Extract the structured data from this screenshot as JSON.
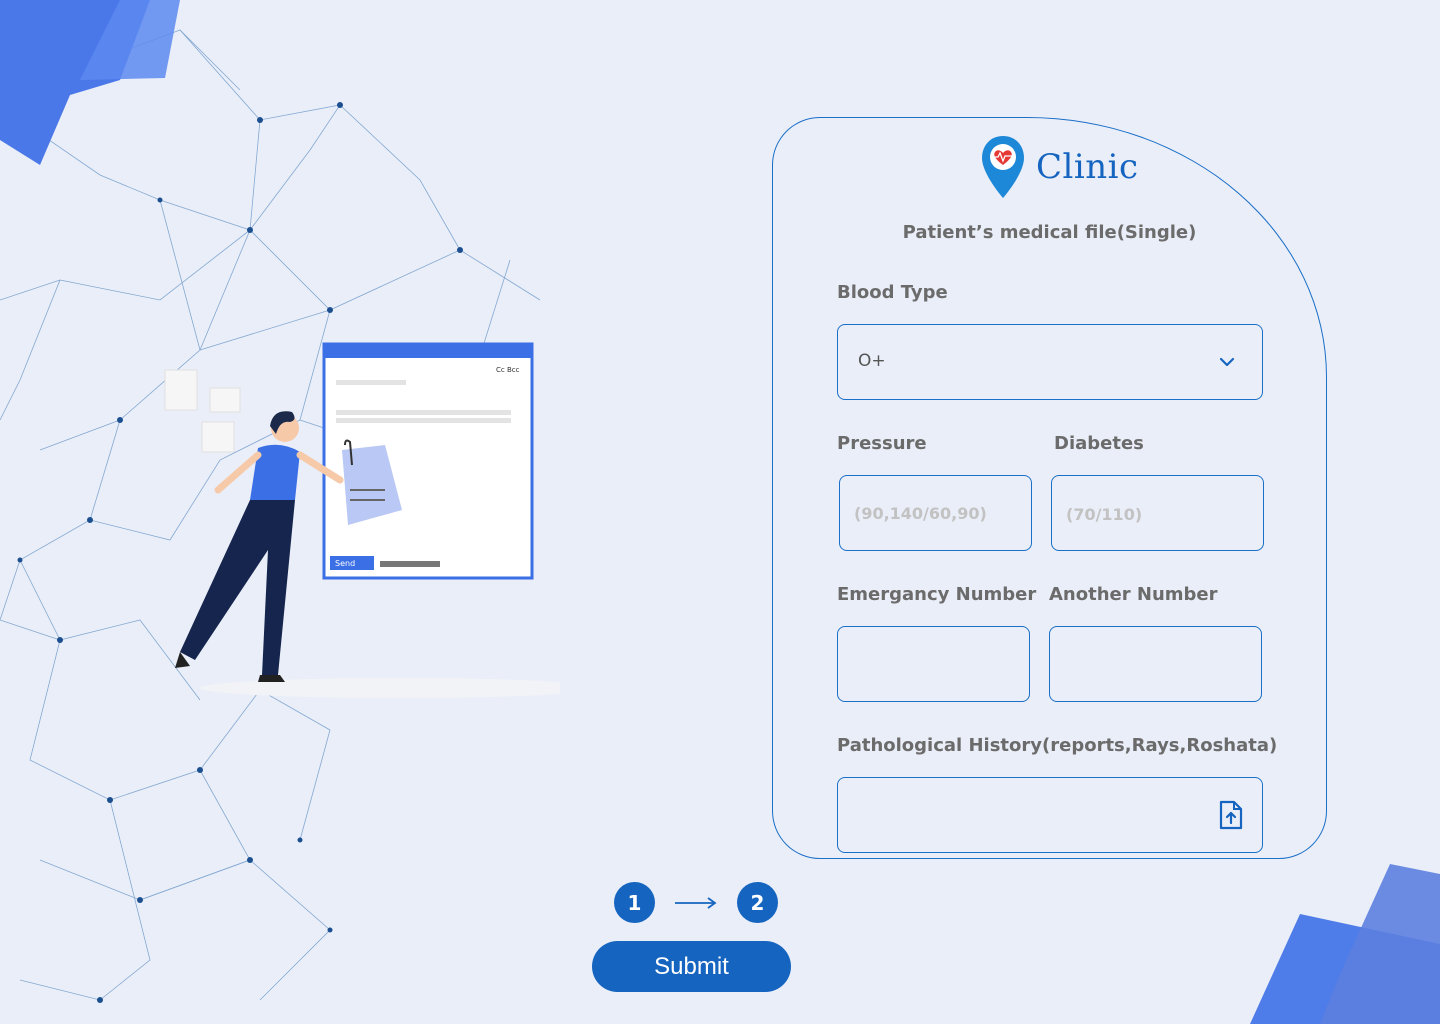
{
  "brand": {
    "name": "Clinic",
    "color": "#1565c0"
  },
  "form": {
    "subtitle": "Patient’s medical file(Single)",
    "blood_type": {
      "label": "Blood Type",
      "value": "O+"
    },
    "pressure": {
      "label": "Pressure",
      "placeholder": "(90,140/60,90)"
    },
    "diabetes": {
      "label": "Diabetes",
      "placeholder": "(70/110)"
    },
    "emergency_number": {
      "label": "Emergancy Number",
      "placeholder": ""
    },
    "another_number": {
      "label": "Another Number",
      "placeholder": ""
    },
    "pathological_history": {
      "label": "Pathological History(reports,Rays,Roshata)",
      "icon": "upload-file-icon"
    }
  },
  "steps": [
    "1",
    "2"
  ],
  "submit_label": "Submit",
  "illustration": {
    "send_label": "Send",
    "cc_bcc": "Cc Bcc"
  }
}
